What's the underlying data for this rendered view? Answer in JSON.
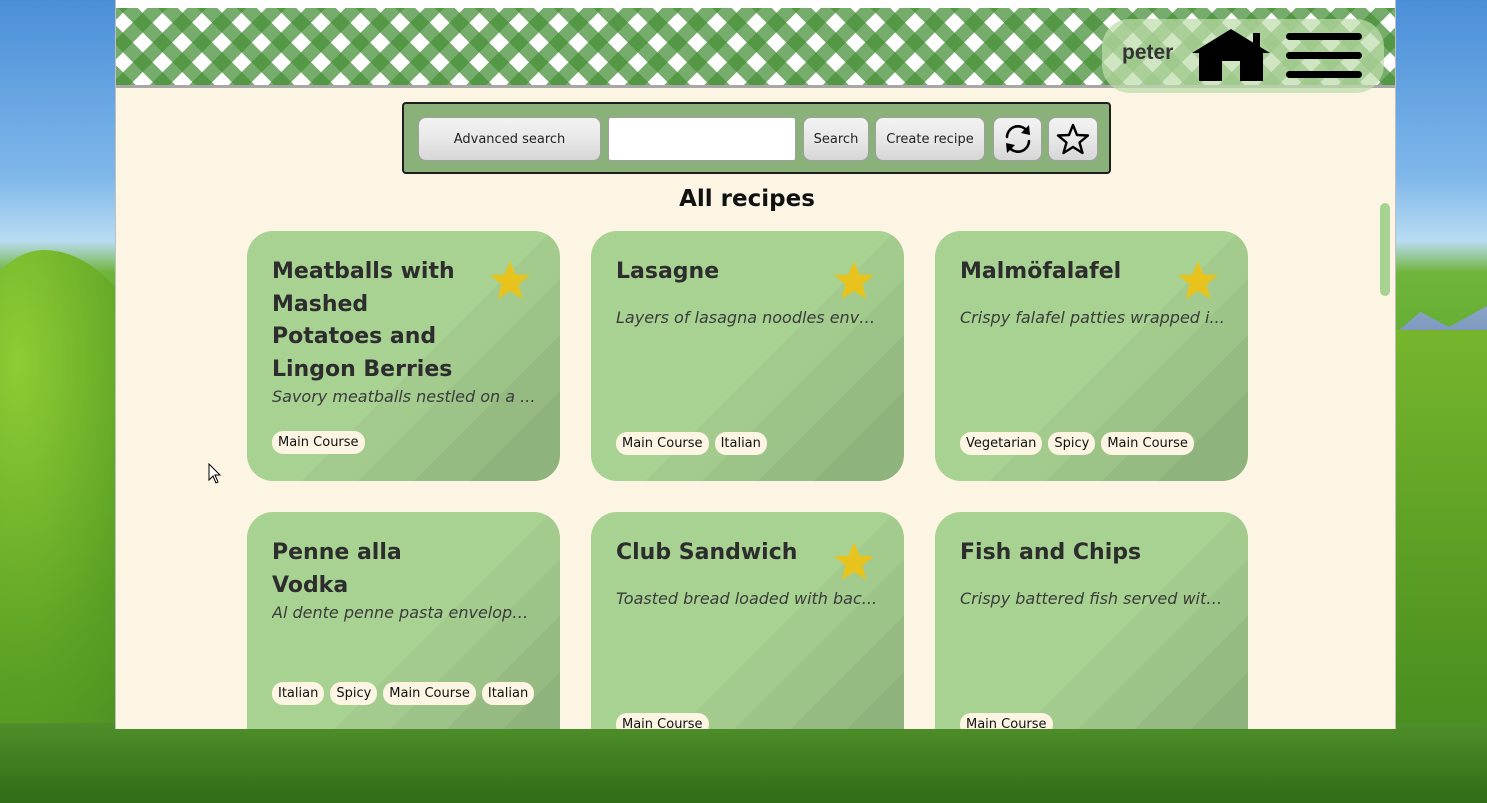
{
  "header": {
    "username": "peter",
    "home_icon": "home-icon",
    "menu_icon": "hamburger-menu-icon"
  },
  "toolbar": {
    "advanced_search_label": "Advanced search",
    "search_value": "",
    "search_label": "Search",
    "create_label": "Create recipe",
    "refresh_icon": "refresh-icon",
    "favorites_icon": "star-outline-icon"
  },
  "main": {
    "title": "All recipes",
    "recipes": [
      {
        "title": "Meatballs with Mashed Potatoes and Lingon Berries",
        "description": "Savory meatballs nestled on a ...",
        "favorite": true,
        "tags": [
          "Main Course"
        ]
      },
      {
        "title": "Lasagne",
        "description": "Layers of lasagna noodles enve...",
        "favorite": true,
        "tags": [
          "Main Course",
          "Italian"
        ]
      },
      {
        "title": "Malmöfalafel",
        "description": "Crispy falafel patties wrapped i...",
        "favorite": true,
        "tags": [
          "Vegetarian",
          "Spicy",
          "Main Course"
        ]
      },
      {
        "title": "Penne alla Vodka",
        "description": "Al dente penne pasta envelope...",
        "favorite": false,
        "tags": [
          "Italian",
          "Spicy",
          "Main Course",
          "Italian"
        ]
      },
      {
        "title": "Club Sandwich",
        "description": "Toasted bread loaded with bac...",
        "favorite": true,
        "tags": [
          "Main Course"
        ]
      },
      {
        "title": "Fish and Chips",
        "description": "Crispy battered fish served with...",
        "favorite": false,
        "tags": [
          "Main Course"
        ]
      }
    ]
  },
  "colors": {
    "card_background": "#a8d292",
    "page_background": "#fcf5e3",
    "toolbar_background": "#8ab17a",
    "star_fill": "#e8c31e",
    "header_pattern": "#48913a"
  }
}
